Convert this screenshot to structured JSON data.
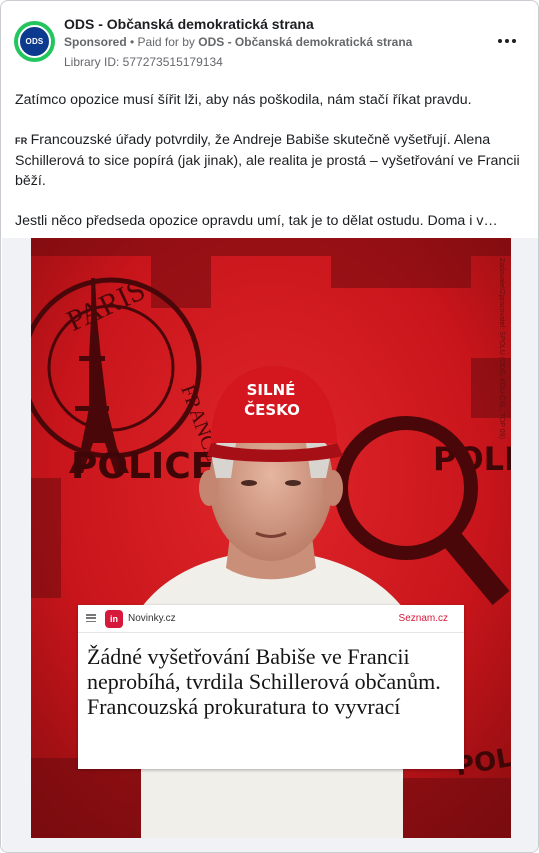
{
  "ad": {
    "page_name": "ODS - Občanská demokratická strana",
    "avatar_text": "ODS",
    "sponsored": "Sponsored",
    "paid_for_prefix": "• Paid for by",
    "paid_for_name": "ODS - Občanská demokratická strana",
    "library_id": "Library ID: 577273515179134",
    "body": {
      "p1": "Zatímco opozice musí šířit lži, aby nás poškodila, nám stačí říkat pravdu.",
      "flag": "FR",
      "p2": "Francouzské úřady potvrdily, že Andreje Babiše skutečně vyšetřují. Alena Schillerová to sice popírá (jak jinak), ale realita je prostá – vyšetřování ve Francii běží.",
      "p3": "Jestli něco předseda opozice opravdu umí, tak je to dělat ostudu. Doma i v…"
    }
  },
  "image": {
    "cap_text_line1": "SILNÉ",
    "cap_text_line2": "ČESKO",
    "stamp_text_top": "PARIS",
    "stamp_text_side": "FRANCE",
    "police_text": "POLICE",
    "police_text_right": "POLI",
    "police_text_bottom": "POLICE",
    "credit": "Zadavatel/Zpracovatel: SPOLU (ODS, KDU-ČSL, TOP 09)",
    "article": {
      "logo": "in",
      "site": "Novinky.cz",
      "partner": "Seznam.cz",
      "headline": "Žádné vyšetřování Babiše ve Francii neprobíhá, tvrdila Schillerová občanům. Francouzská prokuratura to vyvrací"
    }
  },
  "colors": {
    "background_red": "#c8151b",
    "dark_red": "#5e0a0c",
    "cap_red": "#d4161e",
    "avatar_ring": "#22c55e",
    "avatar_fill": "#0b3a8f",
    "novinky_red": "#d6183a"
  }
}
